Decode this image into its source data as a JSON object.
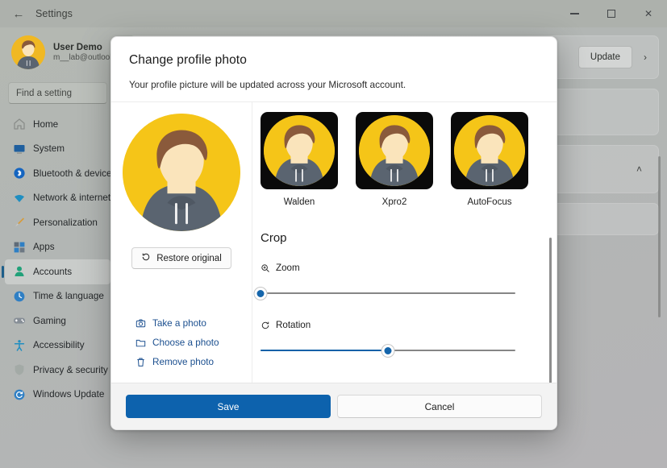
{
  "window": {
    "title": "Settings",
    "back_icon": "back-arrow-icon",
    "controls": {
      "minimize": "minimize-icon",
      "maximize": "maximize-icon",
      "close": "close-icon"
    }
  },
  "sidebar": {
    "profile": {
      "name": "User Demo",
      "email": "m__lab@outlook."
    },
    "search": {
      "placeholder": "Find a setting",
      "value": "Find a setting"
    },
    "items": [
      {
        "label": "Home",
        "icon": "home-icon",
        "selected": false
      },
      {
        "label": "System",
        "icon": "monitor-icon",
        "selected": false
      },
      {
        "label": "Bluetooth & devices",
        "icon": "bluetooth-icon",
        "selected": false
      },
      {
        "label": "Network & internet",
        "icon": "wifi-icon",
        "selected": false
      },
      {
        "label": "Personalization",
        "icon": "brush-icon",
        "selected": false
      },
      {
        "label": "Apps",
        "icon": "apps-icon",
        "selected": false
      },
      {
        "label": "Accounts",
        "icon": "person-icon",
        "selected": true
      },
      {
        "label": "Time & language",
        "icon": "clock-icon",
        "selected": false
      },
      {
        "label": "Gaming",
        "icon": "gamepad-icon",
        "selected": false
      },
      {
        "label": "Accessibility",
        "icon": "accessibility-icon",
        "selected": false
      },
      {
        "label": "Privacy & security",
        "icon": "shield-icon",
        "selected": false
      },
      {
        "label": "Windows Update",
        "icon": "update-icon",
        "selected": false
      }
    ]
  },
  "background": {
    "update_button": "Update",
    "chevron_right": "›",
    "chevron_up": "˄"
  },
  "dialog": {
    "title": "Change profile photo",
    "subtitle": "Your profile picture will be updated across your Microsoft account.",
    "restore_button": "Restore original",
    "restore_icon": "restore-icon",
    "photo_actions": [
      {
        "label": "Take a photo",
        "icon": "camera-icon"
      },
      {
        "label": "Choose a photo",
        "icon": "folder-icon"
      },
      {
        "label": "Remove photo",
        "icon": "trash-icon"
      }
    ],
    "filters": [
      {
        "label": "Walden"
      },
      {
        "label": "Xpro2"
      },
      {
        "label": "AutoFocus"
      }
    ],
    "crop": {
      "heading": "Crop",
      "zoom": {
        "label": "Zoom",
        "icon": "zoom-in-icon",
        "value": 0,
        "min": 0,
        "max": 100
      },
      "rotation": {
        "label": "Rotation",
        "icon": "rotate-icon",
        "value": 50,
        "min": 0,
        "max": 100
      }
    },
    "footer": {
      "save": "Save",
      "cancel": "Cancel"
    }
  },
  "colors": {
    "accent": "#0d62ad",
    "avatar_background": "#f5c518",
    "hair": "#8a5a3b",
    "skin": "#fae4bb",
    "hoodie": "#5a6470",
    "thumb_background": "#0a0a0a",
    "link": "#1b4f8f"
  }
}
